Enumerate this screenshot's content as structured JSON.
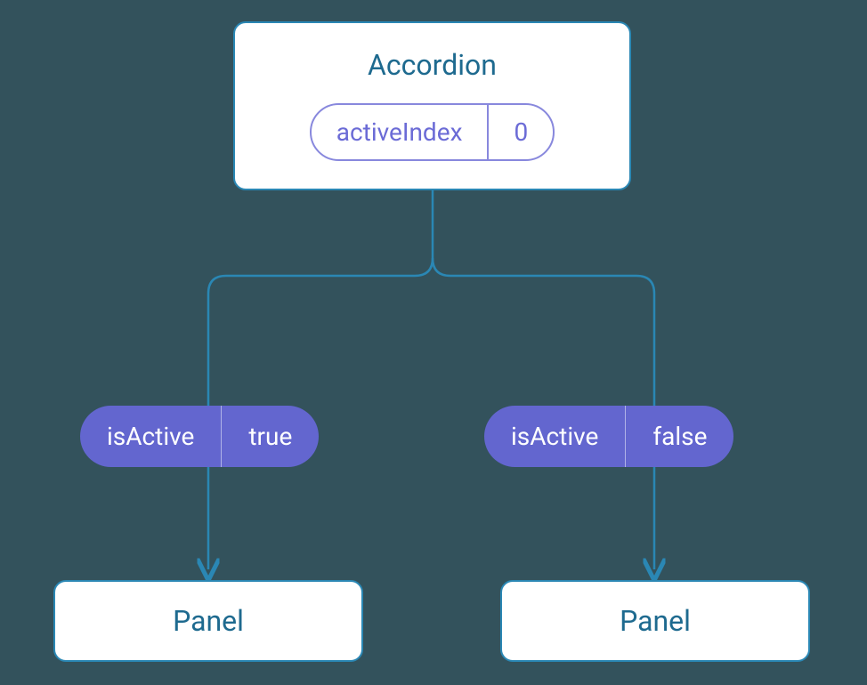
{
  "accordion": {
    "title": "Accordion",
    "state": {
      "key": "activeIndex",
      "value": "0"
    }
  },
  "children": [
    {
      "props": {
        "key": "isActive",
        "value": "true"
      },
      "component": "Panel"
    },
    {
      "props": {
        "key": "isActive",
        "value": "false"
      },
      "component": "Panel"
    }
  ],
  "colors": {
    "background": "#33525c",
    "box_bg": "#ffffff",
    "box_border": "#2a87b4",
    "text_teal": "#1e6a8f",
    "pill_border": "#8888dd",
    "pill_text": "#6b6bd6",
    "props_bg": "#6366cf",
    "props_text": "#ffffff"
  }
}
